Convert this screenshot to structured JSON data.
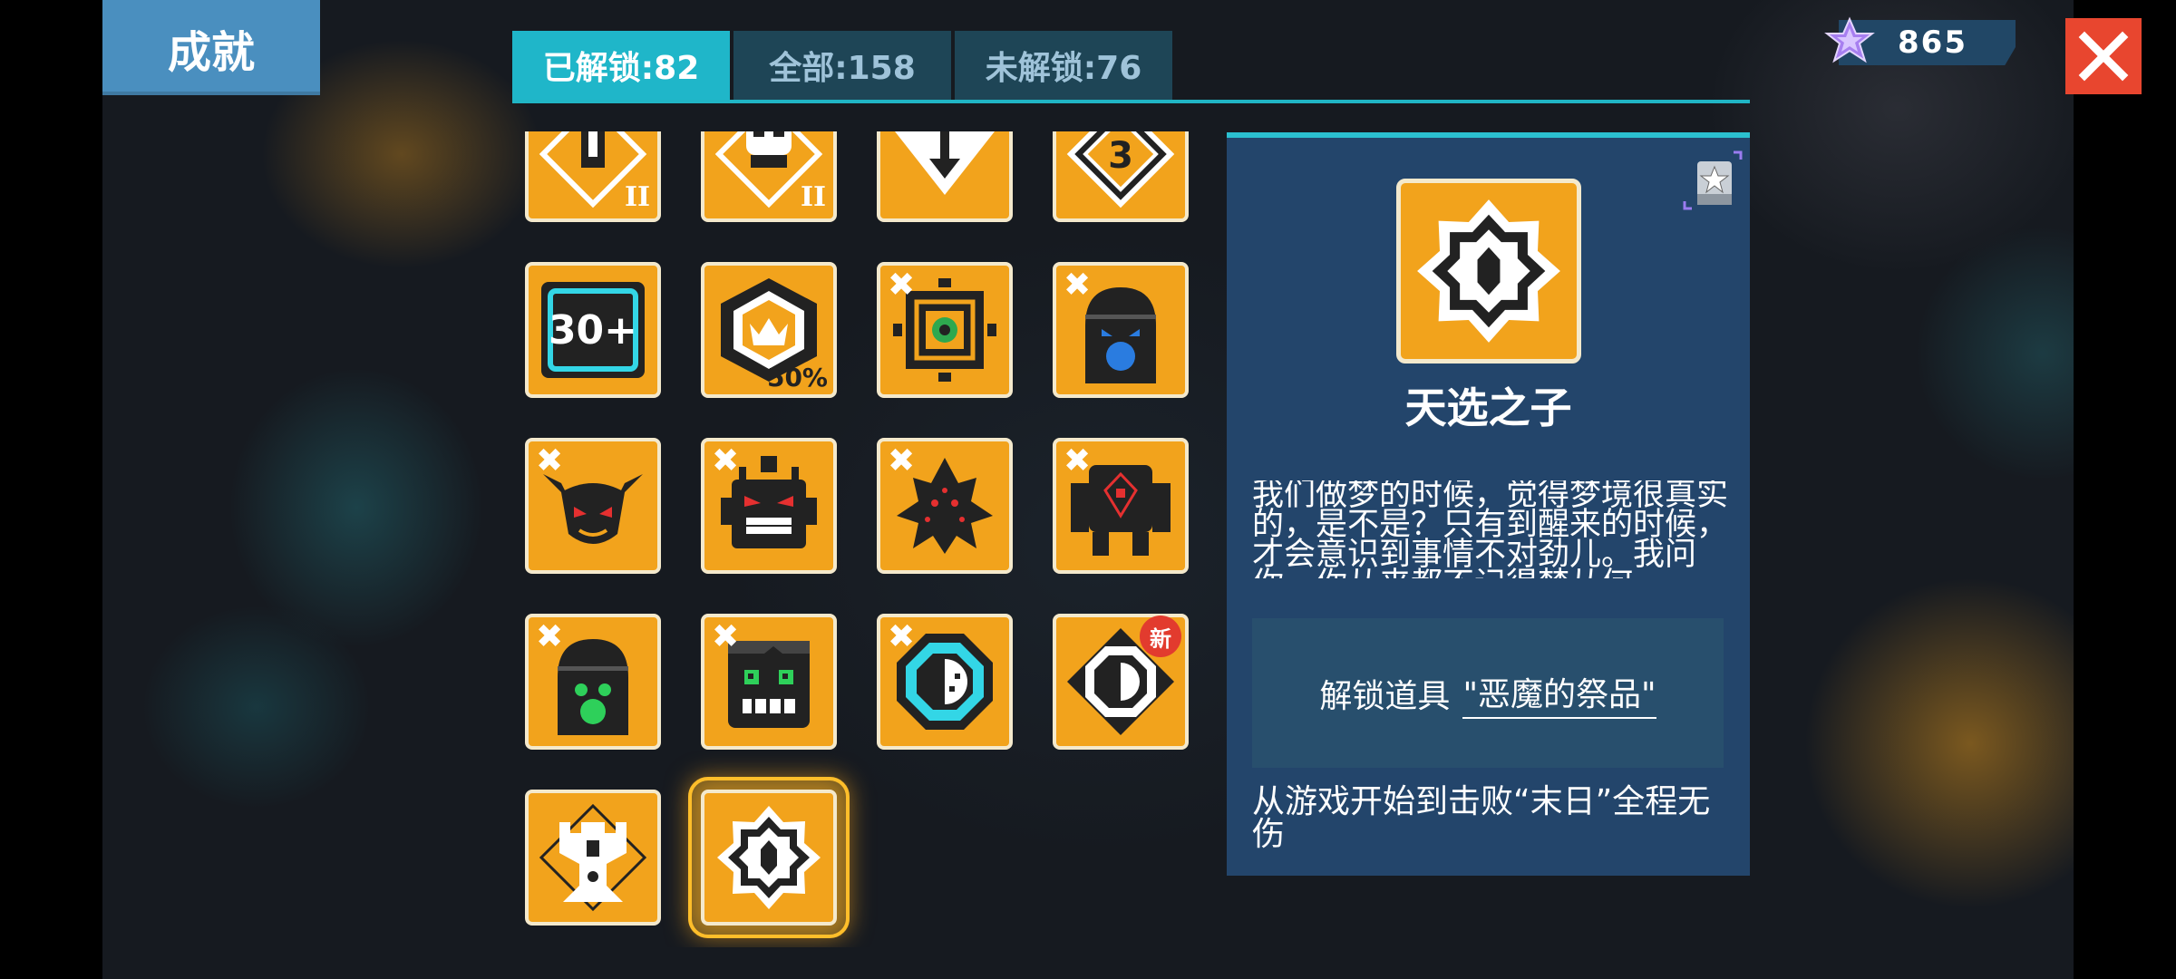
{
  "header": {
    "title": "成就",
    "tabs": [
      {
        "label": "已解锁:82",
        "active": true
      },
      {
        "label": "全部:158",
        "active": false
      },
      {
        "label": "未解锁:76",
        "active": false
      }
    ],
    "currency": {
      "value": "865",
      "icon": "purple-star-gem-icon"
    }
  },
  "badge_text": {
    "thirty_plus": "30+",
    "fifty_percent": "50%",
    "three": "3",
    "roman_two": "II",
    "x_mark": "✖",
    "new": "新"
  },
  "detail": {
    "name": "天选之子",
    "description": "我们做梦的时候，觉得梦境很真实的，是不是？只有到醒来的时候，才会意识到事情不对劲儿。我问你，你从来都不记得梦从何",
    "unlock_prefix": "解锁道具",
    "unlock_item": "\"恶魔的祭品\"",
    "condition": "从游戏开始到击败“末日”全程无伤"
  },
  "colors": {
    "accent": "#1fb6c9",
    "badge_bg": "#f2a31c",
    "panel_bg": "#23456b",
    "close": "#e8462f"
  }
}
